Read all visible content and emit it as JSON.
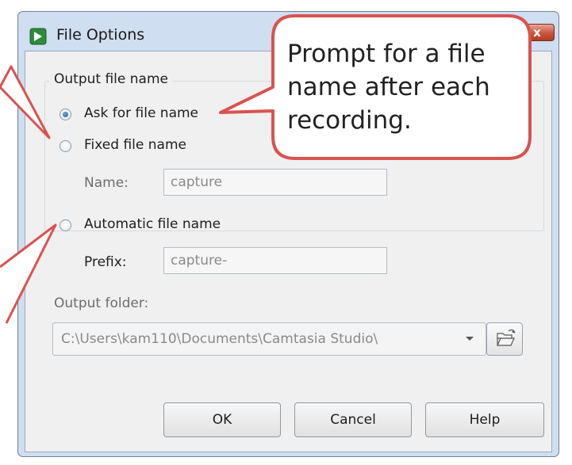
{
  "window": {
    "title": "File Options",
    "close_label": "x"
  },
  "output_group": {
    "legend": "Output file name",
    "options": [
      {
        "label": "Ask for file name",
        "checked": true
      },
      {
        "label": "Fixed file name",
        "checked": false
      },
      {
        "label": "Automatic file name",
        "checked": false
      }
    ],
    "name_label": "Name:",
    "name_value": "capture",
    "prefix_label": "Prefix:",
    "prefix_value": "capture-"
  },
  "output_folder": {
    "label": "Output folder:",
    "value": "C:\\Users\\kam110\\Documents\\Camtasia Studio\\"
  },
  "buttons": {
    "ok": "OK",
    "cancel": "Cancel",
    "help": "Help"
  },
  "callout": {
    "lines": [
      "Prompt for a file",
      "name after each",
      "recording."
    ],
    "border_color": "#d9534f"
  }
}
